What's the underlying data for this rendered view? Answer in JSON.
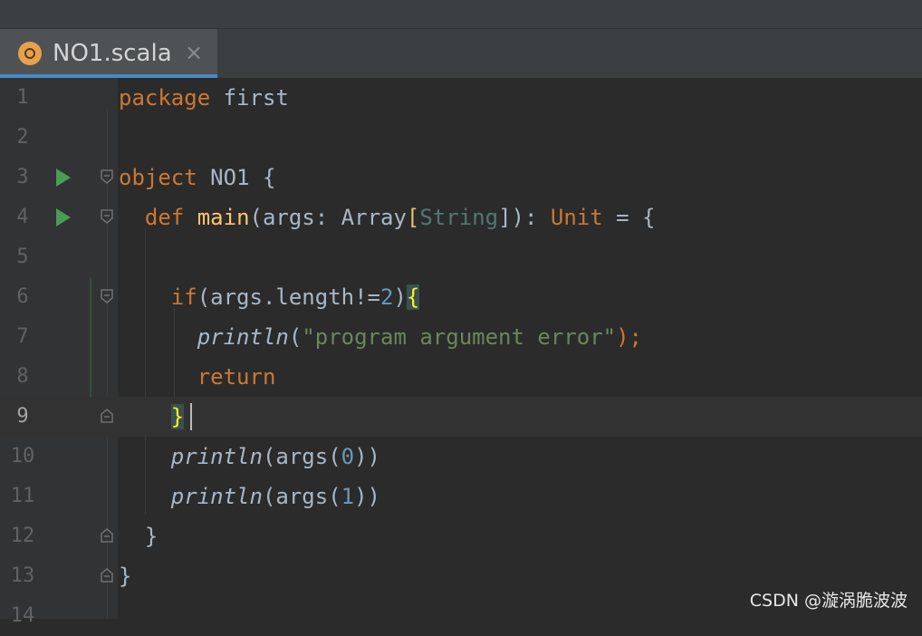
{
  "tab": {
    "filename": "NO1.scala",
    "icon": "scala-file-icon",
    "close": "×"
  },
  "gutter": {
    "line_numbers": [
      "1",
      "2",
      "3",
      "4",
      "5",
      "6",
      "7",
      "8",
      "9",
      "10",
      "11",
      "12",
      "13",
      "14"
    ]
  },
  "code": {
    "l1": {
      "kw": "package",
      "rest": " first"
    },
    "l3": {
      "kw": "object",
      "rest": " NO1 {"
    },
    "l4": {
      "indent": "  ",
      "kw": "def",
      "name": " main",
      "p1": "(args: ",
      "arr": "Array",
      "lb": "[",
      "str_t": "String",
      "rb": "])",
      "colon": ": ",
      "unit": "Unit",
      "tail": " = {"
    },
    "l6": {
      "indent": "    ",
      "kw": "if",
      "p": "(args.length!=",
      "n": "2",
      "close": ")",
      "brace": "{"
    },
    "l7": {
      "indent": "      ",
      "fn": "println",
      "open": "(",
      "str": "\"program argument error\"",
      "close": ");"
    },
    "l8": {
      "indent": "      ",
      "kw": "return"
    },
    "l9": {
      "indent": "    ",
      "brace": "}"
    },
    "l10": {
      "indent": "    ",
      "fn": "println",
      "p": "(args(",
      "n": "0",
      "close": "))"
    },
    "l11": {
      "indent": "    ",
      "fn": "println",
      "p": "(args(",
      "n": "1",
      "close": "))"
    },
    "l12": {
      "indent": "  ",
      "brace": "}"
    },
    "l13": {
      "brace": "}"
    }
  },
  "watermark": "CSDN @漩涡脆波波",
  "colors": {
    "background": "#2b2b2b",
    "keyword": "#cc7832",
    "string": "#6a8759",
    "number": "#6897bb",
    "default": "#a9b7c6",
    "run_icon": "#499c54",
    "tab_underline": "#4a88c7"
  }
}
